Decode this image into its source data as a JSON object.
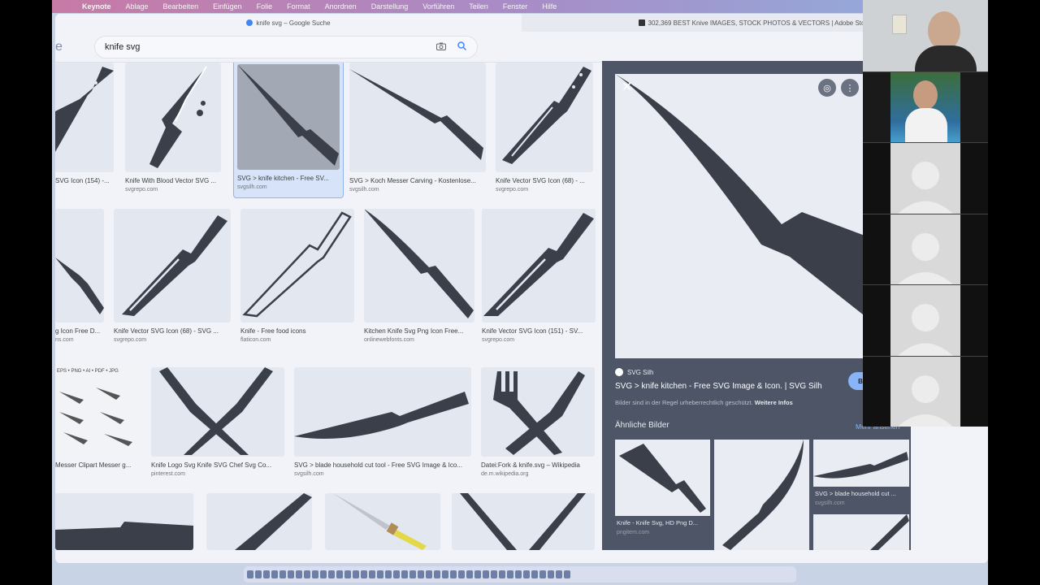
{
  "menubar": {
    "app": "Keynote",
    "items": [
      "Ablage",
      "Bearbeiten",
      "Einfügen",
      "Folie",
      "Format",
      "Anordnen",
      "Darstellung",
      "Vorführen",
      "Teilen",
      "Fenster",
      "Hilfe"
    ]
  },
  "tabs": [
    {
      "label": "knife svg – Google Suche"
    },
    {
      "label": "302,369 BEST Knive IMAGES, STOCK PHOTOS & VECTORS | Adobe Stock"
    }
  ],
  "search": {
    "logo_fragment": "e",
    "query": "knife svg"
  },
  "results": [
    {
      "caption": "SVG Icon (154) -...",
      "source": ""
    },
    {
      "caption": "Knife With Blood Vector SVG ...",
      "source": "svgrepo.com"
    },
    {
      "caption": "SVG > knife kitchen - Free SV...",
      "source": "svgsilh.com"
    },
    {
      "caption": "SVG > Koch Messer Carving - Kostenlose...",
      "source": "svgsilh.com"
    },
    {
      "caption": "Knife Vector SVG Icon (68) - ...",
      "source": "svgrepo.com"
    },
    {
      "caption": "g Icon Free D...",
      "source": "ns.com"
    },
    {
      "caption": "Knife Vector SVG Icon (68) - SVG ...",
      "source": "svgrepo.com"
    },
    {
      "caption": "Knife - Free food icons",
      "source": "flaticon.com"
    },
    {
      "caption": "Kitchen Knife Svg Png Icon Free...",
      "source": "onlinewebfonts.com"
    },
    {
      "caption": "Knife Vector SVG Icon (151) - SV...",
      "source": "svgrepo.com"
    },
    {
      "caption": "Messer Clipart Messer g...",
      "source": ""
    },
    {
      "caption": "Knife Logo Svg Knife SVG Chef Svg Co...",
      "source": "pinterest.com"
    },
    {
      "caption": "SVG > blade household cut tool - Free SVG Image & Ico...",
      "source": "svgsilh.com"
    },
    {
      "caption": "Datei:Fork & knife.svg – Wikipedia",
      "source": "de.m.wikipedia.org"
    }
  ],
  "clipart_banner": "EPS • PNG • AI • PDF • JPG",
  "preview": {
    "source_name": "SVG Silh",
    "title": "SVG > knife kitchen - Free SVG Image & Icon. | SVG Silh",
    "visit_label": "B",
    "note": "Bilder sind in der Regel urheberrechtlich geschützt.",
    "note_link": "Weitere Infos",
    "similar_heading": "Ähnliche Bilder",
    "more_label": "Mehr ansehen",
    "similar": [
      {
        "caption": "Knife - Knife Svg, HD Png D...",
        "source": "pngitem.com"
      },
      {
        "caption": "",
        "source": ""
      },
      {
        "caption": "SVG > blade household cut ...",
        "source": "svgsilh.com"
      }
    ]
  },
  "colors": {
    "knife": "#3a3f4a",
    "accent": "#8ab4f8",
    "panel": "#4d5566"
  }
}
